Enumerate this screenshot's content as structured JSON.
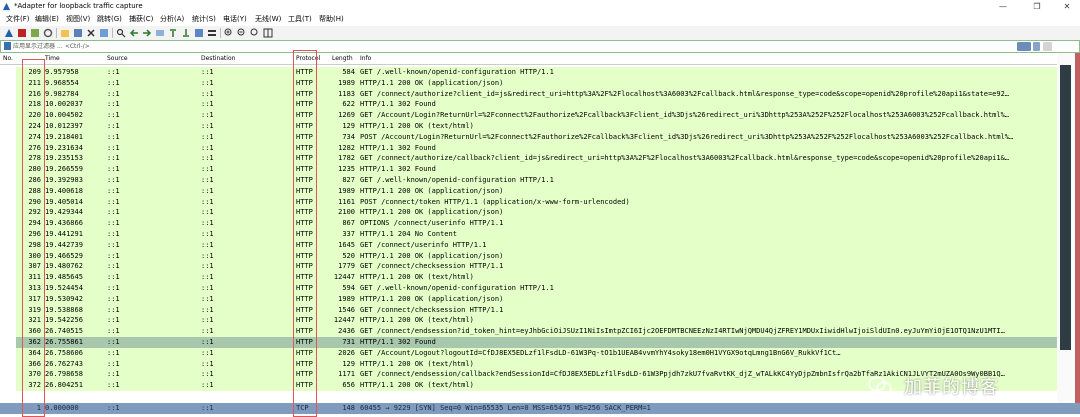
{
  "window": {
    "title": "*Adapter for loopback traffic capture",
    "minimize": "—",
    "maximize": "❐",
    "close": "✕"
  },
  "menu": [
    "文件(F)",
    "编辑(E)",
    "视图(V)",
    "跳转(G)",
    "捕获(C)",
    "分析(A)",
    "统计(S)",
    "电话(Y)",
    "无线(W)",
    "工具(T)",
    "帮助(H)"
  ],
  "filter": {
    "placeholder": "应用显示过滤器 … <Ctrl-/>"
  },
  "columns": {
    "no": "No.",
    "time": "Time",
    "source": "Source",
    "destination": "Destination",
    "protocol": "Protocol",
    "length": "Length",
    "info": "Info"
  },
  "packets": [
    {
      "no": "209",
      "time": "9.957958",
      "src": "::1",
      "dst": "::1",
      "proto": "HTTP",
      "len": "584",
      "info": "GET /.well-known/openid-configuration HTTP/1.1"
    },
    {
      "no": "211",
      "time": "9.968554",
      "src": "::1",
      "dst": "::1",
      "proto": "HTTP",
      "len": "1989",
      "info": "HTTP/1.1 200 OK  (application/json)"
    },
    {
      "no": "216",
      "time": "9.982784",
      "src": "::1",
      "dst": "::1",
      "proto": "HTTP",
      "len": "1183",
      "info": "GET /connect/authorize?client_id=js&redirect_uri=http%3A%2F%2Flocalhost%3A6003%2Fcallback.html&response_type=code&scope=openid%20profile%20api1&state=e92…"
    },
    {
      "no": "218",
      "time": "10.002037",
      "src": "::1",
      "dst": "::1",
      "proto": "HTTP",
      "len": "622",
      "info": "HTTP/1.1 302 Found"
    },
    {
      "no": "220",
      "time": "10.004502",
      "src": "::1",
      "dst": "::1",
      "proto": "HTTP",
      "len": "1269",
      "info": "GET /Account/Login?ReturnUrl=%2Fconnect%2Fauthorize%2Fcallback%3Fclient_id%3Djs%26redirect_uri%3Dhttp%253A%252F%252Flocalhost%253A6003%252Fcallback.html%…"
    },
    {
      "no": "224",
      "time": "10.012397",
      "src": "::1",
      "dst": "::1",
      "proto": "HTTP",
      "len": "129",
      "info": "HTTP/1.1 200 OK  (text/html)"
    },
    {
      "no": "274",
      "time": "19.218401",
      "src": "::1",
      "dst": "::1",
      "proto": "HTTP",
      "len": "734",
      "info": "POST /Account/Login?ReturnUrl=%2Fconnect%2Fauthorize%2Fcallback%3Fclient_id%3Djs%26redirect_uri%3Dhttp%253A%252F%252Flocalhost%253A6003%252Fcallback.html%…"
    },
    {
      "no": "276",
      "time": "19.231634",
      "src": "::1",
      "dst": "::1",
      "proto": "HTTP",
      "len": "1282",
      "info": "HTTP/1.1 302 Found"
    },
    {
      "no": "278",
      "time": "19.235153",
      "src": "::1",
      "dst": "::1",
      "proto": "HTTP",
      "len": "1782",
      "info": "GET /connect/authorize/callback?client_id=js&redirect_uri=http%3A%2F%2Flocalhost%3A6003%2Fcallback.html&response_type=code&scope=openid%20profile%20api1&…"
    },
    {
      "no": "280",
      "time": "19.266559",
      "src": "::1",
      "dst": "::1",
      "proto": "HTTP",
      "len": "1235",
      "info": "HTTP/1.1 302 Found"
    },
    {
      "no": "286",
      "time": "19.392983",
      "src": "::1",
      "dst": "::1",
      "proto": "HTTP",
      "len": "827",
      "info": "GET /.well-known/openid-configuration HTTP/1.1"
    },
    {
      "no": "288",
      "time": "19.400618",
      "src": "::1",
      "dst": "::1",
      "proto": "HTTP",
      "len": "1989",
      "info": "HTTP/1.1 200 OK  (application/json)"
    },
    {
      "no": "290",
      "time": "19.405014",
      "src": "::1",
      "dst": "::1",
      "proto": "HTTP",
      "len": "1161",
      "info": "POST /connect/token HTTP/1.1  (application/x-www-form-urlencoded)"
    },
    {
      "no": "292",
      "time": "19.429344",
      "src": "::1",
      "dst": "::1",
      "proto": "HTTP",
      "len": "2100",
      "info": "HTTP/1.1 200 OK  (application/json)"
    },
    {
      "no": "294",
      "time": "19.436866",
      "src": "::1",
      "dst": "::1",
      "proto": "HTTP",
      "len": "867",
      "info": "OPTIONS /connect/userinfo HTTP/1.1"
    },
    {
      "no": "296",
      "time": "19.441291",
      "src": "::1",
      "dst": "::1",
      "proto": "HTTP",
      "len": "337",
      "info": "HTTP/1.1 204 No Content"
    },
    {
      "no": "298",
      "time": "19.442739",
      "src": "::1",
      "dst": "::1",
      "proto": "HTTP",
      "len": "1645",
      "info": "GET /connect/userinfo HTTP/1.1"
    },
    {
      "no": "300",
      "time": "19.466529",
      "src": "::1",
      "dst": "::1",
      "proto": "HTTP",
      "len": "520",
      "info": "HTTP/1.1 200 OK  (application/json)"
    },
    {
      "no": "307",
      "time": "19.480762",
      "src": "::1",
      "dst": "::1",
      "proto": "HTTP",
      "len": "1779",
      "info": "GET /connect/checksession HTTP/1.1"
    },
    {
      "no": "311",
      "time": "19.485645",
      "src": "::1",
      "dst": "::1",
      "proto": "HTTP",
      "len": "12447",
      "info": "HTTP/1.1 200 OK  (text/html)"
    },
    {
      "no": "313",
      "time": "19.524454",
      "src": "::1",
      "dst": "::1",
      "proto": "HTTP",
      "len": "594",
      "info": "GET /.well-known/openid-configuration HTTP/1.1"
    },
    {
      "no": "317",
      "time": "19.530942",
      "src": "::1",
      "dst": "::1",
      "proto": "HTTP",
      "len": "1989",
      "info": "HTTP/1.1 200 OK  (application/json)"
    },
    {
      "no": "319",
      "time": "19.538868",
      "src": "::1",
      "dst": "::1",
      "proto": "HTTP",
      "len": "1546",
      "info": "GET /connect/checksession HTTP/1.1"
    },
    {
      "no": "321",
      "time": "19.542256",
      "src": "::1",
      "dst": "::1",
      "proto": "HTTP",
      "len": "12447",
      "info": "HTTP/1.1 200 OK  (text/html)"
    },
    {
      "no": "360",
      "time": "26.740515",
      "src": "::1",
      "dst": "::1",
      "proto": "HTTP",
      "len": "2436",
      "info": "GET /connect/endsession?id_token_hint=eyJhbGciOiJSUzI1NiIsImtpZCI6Ijc2OEFDMTBCNEEzNzI4RTIwNjQMDU4QjZFREY1MDUxIiwidHlwIjoiSldUIn0.eyJuYmYiOjE1OTQ1NzU1MTI…"
    },
    {
      "no": "362",
      "time": "26.755861",
      "src": "::1",
      "dst": "::1",
      "proto": "HTTP",
      "len": "731",
      "info": "HTTP/1.1 302 Found"
    },
    {
      "no": "364",
      "time": "26.758606",
      "src": "::1",
      "dst": "::1",
      "proto": "HTTP",
      "len": "2026",
      "info": "GET /Account/Logout?logoutId=CfDJ8EX5EDLzf1lFsdLD-61W3Pq-tO1b1UEAB4vvmYhY4soky18em0H1VYGX9otqLmng1BnG6V_RukkVf1Ct… "
    },
    {
      "no": "366",
      "time": "26.762743",
      "src": "::1",
      "dst": "::1",
      "proto": "HTTP",
      "len": "129",
      "info": "HTTP/1.1 200 OK  (text/html)"
    },
    {
      "no": "370",
      "time": "26.798658",
      "src": "::1",
      "dst": "::1",
      "proto": "HTTP",
      "len": "1171",
      "info": "GET /connect/endsession/callback?endSessionId=CfDJ8EX5EDLzf1lFsdLD-61W3Ppjdh7zkU7fvaRvtKK_djZ_wTALkKC4YyDjpZmbnIsfrQa2bTfaRz1AkiCN1JLVYT2mUZA0Os9Wy0BB1Q…"
    },
    {
      "no": "372",
      "time": "26.804251",
      "src": "::1",
      "dst": "::1",
      "proto": "HTTP",
      "len": "656",
      "info": "HTTP/1.1 200 OK  (text/html)"
    }
  ],
  "selected_row": "362",
  "tcp_row": {
    "no": "1",
    "time": "0.000000",
    "src": "::1",
    "dst": "::1",
    "proto": "TCP",
    "len": "148",
    "info": "60455 → 9229 [SYN] Seq=0 Win=65535 Len=0 MSS=65475 WS=256 SACK_PERM=1"
  },
  "watermark": {
    "text": "加菲的博客"
  },
  "colors": {
    "http_row": "#e4ffc7",
    "selected_row": "#a7c8ad",
    "tcp_row": "#7f9cbf",
    "highlight_box": "#e05555"
  }
}
